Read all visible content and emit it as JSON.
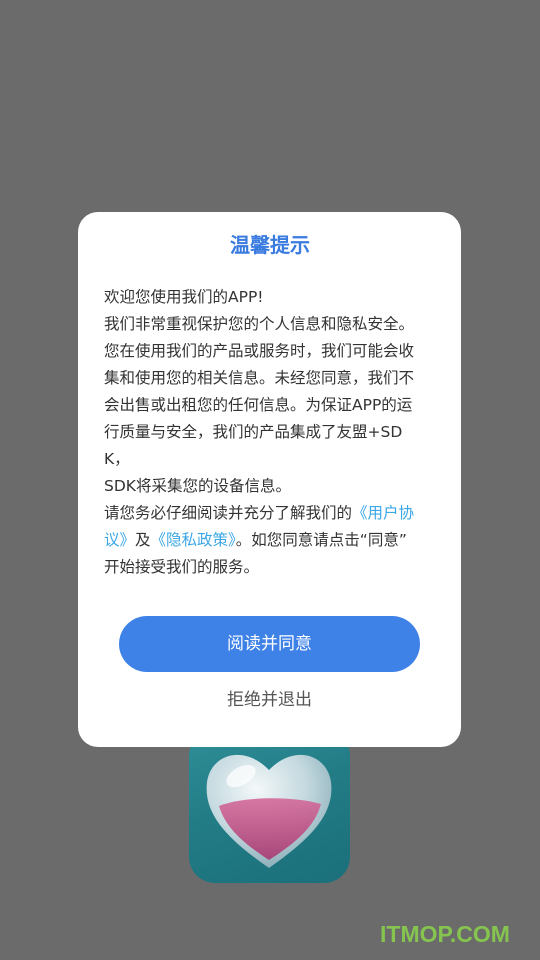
{
  "dialog": {
    "title": "温馨提示",
    "para1": {
      "l1": "欢迎您使用我们的APP!",
      "l2": "我们非常重视保护您的个人信息和隐私安全。",
      "l3": "您在使用我们的产品或服务时，我们可能会收",
      "l4": "集和使用您的相关信息。未经您同意，我们不",
      "l5": "会出售或出租您的任何信息。为保证APP的运",
      "l6": "行质量与安全，我们的产品集成了友盟+SDK，",
      "l7": "SDK将采集您的设备信息。"
    },
    "para2": {
      "prefix": "请您务必仔细阅读并充分了解我们的",
      "user_agreement_link_a": "《用户协",
      "user_agreement_link_b": "议》",
      "and": "及",
      "privacy_link": "《隐私政策》",
      "suffix_a": "。如您同意请点击“同意”",
      "suffix_b": "开始接受我们的服务。"
    },
    "agree_label": "阅读并同意",
    "reject_label": "拒绝并退出"
  },
  "watermark": "ITMOP.COM",
  "colors": {
    "title": "#3a7be0",
    "link": "#3ba7e6",
    "button": "#3e82e8",
    "overlay": "#6b6b6b"
  },
  "icons": {
    "app_icon": "heart-app-icon"
  }
}
